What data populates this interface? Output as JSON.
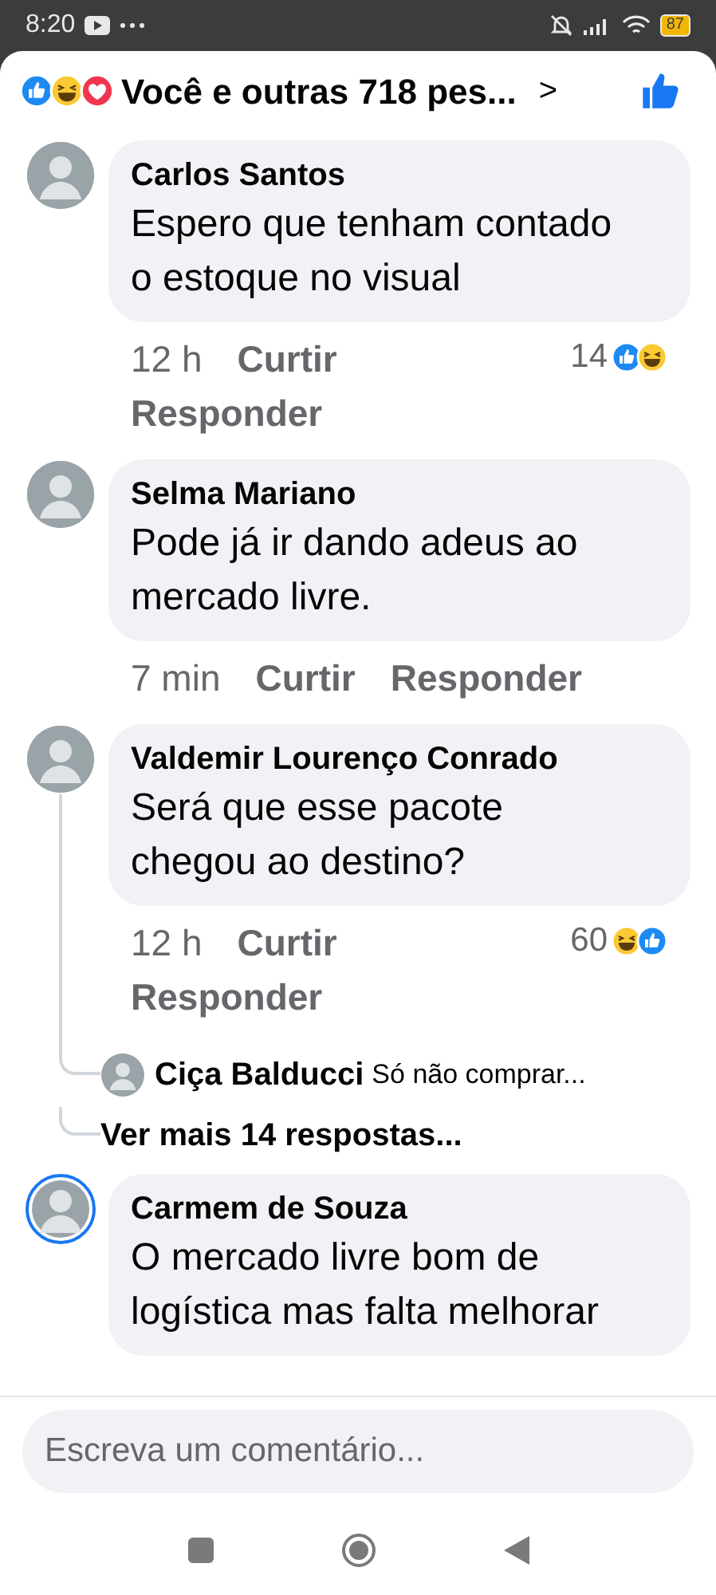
{
  "status_bar": {
    "time": "8:20",
    "battery": "87"
  },
  "header": {
    "reactions": [
      {
        "kind": "like"
      },
      {
        "kind": "haha"
      },
      {
        "kind": "love"
      }
    ],
    "summary": "Você e outras 718 pes...",
    "chevron": ">"
  },
  "comments": [
    {
      "author": "Carlos Santos",
      "body": "Espero que tenham contado o estoque no visual",
      "time": "12 h",
      "actions": [
        "Curtir",
        "Responder"
      ],
      "count": "14",
      "reactions": [
        {
          "kind": "like"
        },
        {
          "kind": "haha"
        }
      ],
      "avatar_ring": false
    },
    {
      "author": "Selma Mariano",
      "body": "Pode já ir dando adeus ao mercado livre.",
      "time": "7 min",
      "actions": [
        "Curtir",
        "Responder"
      ],
      "avatar_ring": false
    },
    {
      "author": "Valdemir Lourenço Conrado",
      "body": "Será que esse pacote chegou ao destino?",
      "time": "12 h",
      "actions": [
        "Curtir",
        "Responder"
      ],
      "count": "60",
      "reactions": [
        {
          "kind": "haha"
        },
        {
          "kind": "like"
        }
      ],
      "avatar_ring": false,
      "replies": [
        {
          "author": "Ciça Balducci",
          "text": "Só não comprar..."
        }
      ],
      "more_replies": "Ver mais 14 respostas..."
    },
    {
      "author": "Carmem de Souza",
      "body": "O mercado livre bom de logística mas falta melhorar",
      "avatar_ring": true
    }
  ],
  "composer": {
    "placeholder": "Escreva um comentário..."
  }
}
